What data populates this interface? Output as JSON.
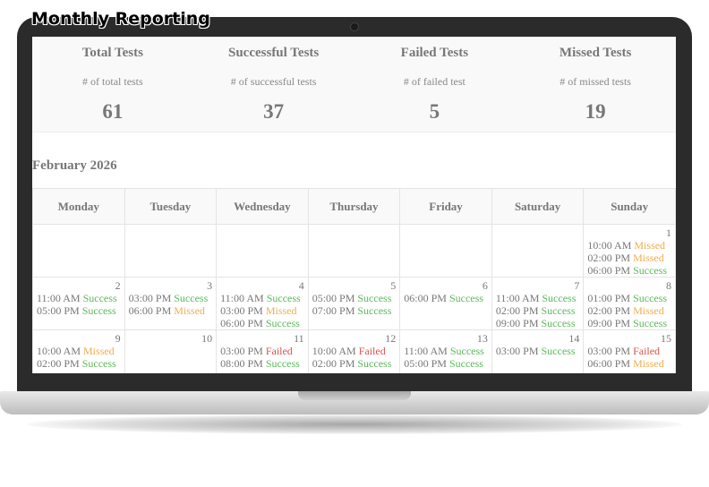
{
  "caption": "Monthly Reporting",
  "colors": {
    "success": "#5cb85c",
    "missed": "#f0ad4e",
    "failed": "#d9534f",
    "bezel": "#2b2b2b"
  },
  "stats": [
    {
      "title": "Total Tests",
      "subtitle": "# of total tests",
      "value": "61"
    },
    {
      "title": "Successful Tests",
      "subtitle": "# of successful tests",
      "value": "37"
    },
    {
      "title": "Failed Tests",
      "subtitle": "# of failed test",
      "value": "5"
    },
    {
      "title": "Missed Tests",
      "subtitle": "# of missed tests",
      "value": "19"
    }
  ],
  "calendar": {
    "month_title": "February 2026",
    "weekdays": [
      "Monday",
      "Tuesday",
      "Wednesday",
      "Thursday",
      "Friday",
      "Saturday",
      "Sunday"
    ],
    "weeks": [
      [
        {
          "day": "",
          "events": []
        },
        {
          "day": "",
          "events": []
        },
        {
          "day": "",
          "events": []
        },
        {
          "day": "",
          "events": []
        },
        {
          "day": "",
          "events": []
        },
        {
          "day": "",
          "events": []
        },
        {
          "day": "1",
          "events": [
            {
              "time": "10:00 AM",
              "status": "Missed"
            },
            {
              "time": "02:00 PM",
              "status": "Missed"
            },
            {
              "time": "06:00 PM",
              "status": "Success"
            }
          ]
        }
      ],
      [
        {
          "day": "2",
          "events": [
            {
              "time": "11:00 AM",
              "status": "Success"
            },
            {
              "time": "05:00 PM",
              "status": "Success"
            }
          ]
        },
        {
          "day": "3",
          "events": [
            {
              "time": "03:00 PM",
              "status": "Success"
            },
            {
              "time": "06:00 PM",
              "status": "Missed"
            }
          ]
        },
        {
          "day": "4",
          "events": [
            {
              "time": "11:00 AM",
              "status": "Success"
            },
            {
              "time": "03:00 PM",
              "status": "Missed"
            },
            {
              "time": "06:00 PM",
              "status": "Success"
            }
          ]
        },
        {
          "day": "5",
          "events": [
            {
              "time": "05:00 PM",
              "status": "Success"
            },
            {
              "time": "07:00 PM",
              "status": "Success"
            }
          ]
        },
        {
          "day": "6",
          "events": [
            {
              "time": "06:00 PM",
              "status": "Success"
            }
          ]
        },
        {
          "day": "7",
          "events": [
            {
              "time": "11:00 AM",
              "status": "Success"
            },
            {
              "time": "02:00 PM",
              "status": "Success"
            },
            {
              "time": "09:00 PM",
              "status": "Success"
            }
          ]
        },
        {
          "day": "8",
          "events": [
            {
              "time": "01:00 PM",
              "status": "Success"
            },
            {
              "time": "02:00 PM",
              "status": "Missed"
            },
            {
              "time": "09:00 PM",
              "status": "Success"
            }
          ]
        }
      ],
      [
        {
          "day": "9",
          "events": [
            {
              "time": "10:00 AM",
              "status": "Missed"
            },
            {
              "time": "02:00 PM",
              "status": "Success"
            }
          ]
        },
        {
          "day": "10",
          "events": []
        },
        {
          "day": "11",
          "events": [
            {
              "time": "03:00 PM",
              "status": "Failed"
            },
            {
              "time": "08:00 PM",
              "status": "Success"
            }
          ]
        },
        {
          "day": "12",
          "events": [
            {
              "time": "10:00 AM",
              "status": "Failed"
            },
            {
              "time": "02:00 PM",
              "status": "Success"
            }
          ]
        },
        {
          "day": "13",
          "events": [
            {
              "time": "11:00 AM",
              "status": "Success"
            },
            {
              "time": "05:00 PM",
              "status": "Success"
            }
          ]
        },
        {
          "day": "14",
          "events": [
            {
              "time": "03:00 PM",
              "status": "Success"
            }
          ]
        },
        {
          "day": "15",
          "events": [
            {
              "time": "03:00 PM",
              "status": "Failed"
            },
            {
              "time": "06:00 PM",
              "status": "Missed"
            }
          ]
        }
      ]
    ]
  }
}
